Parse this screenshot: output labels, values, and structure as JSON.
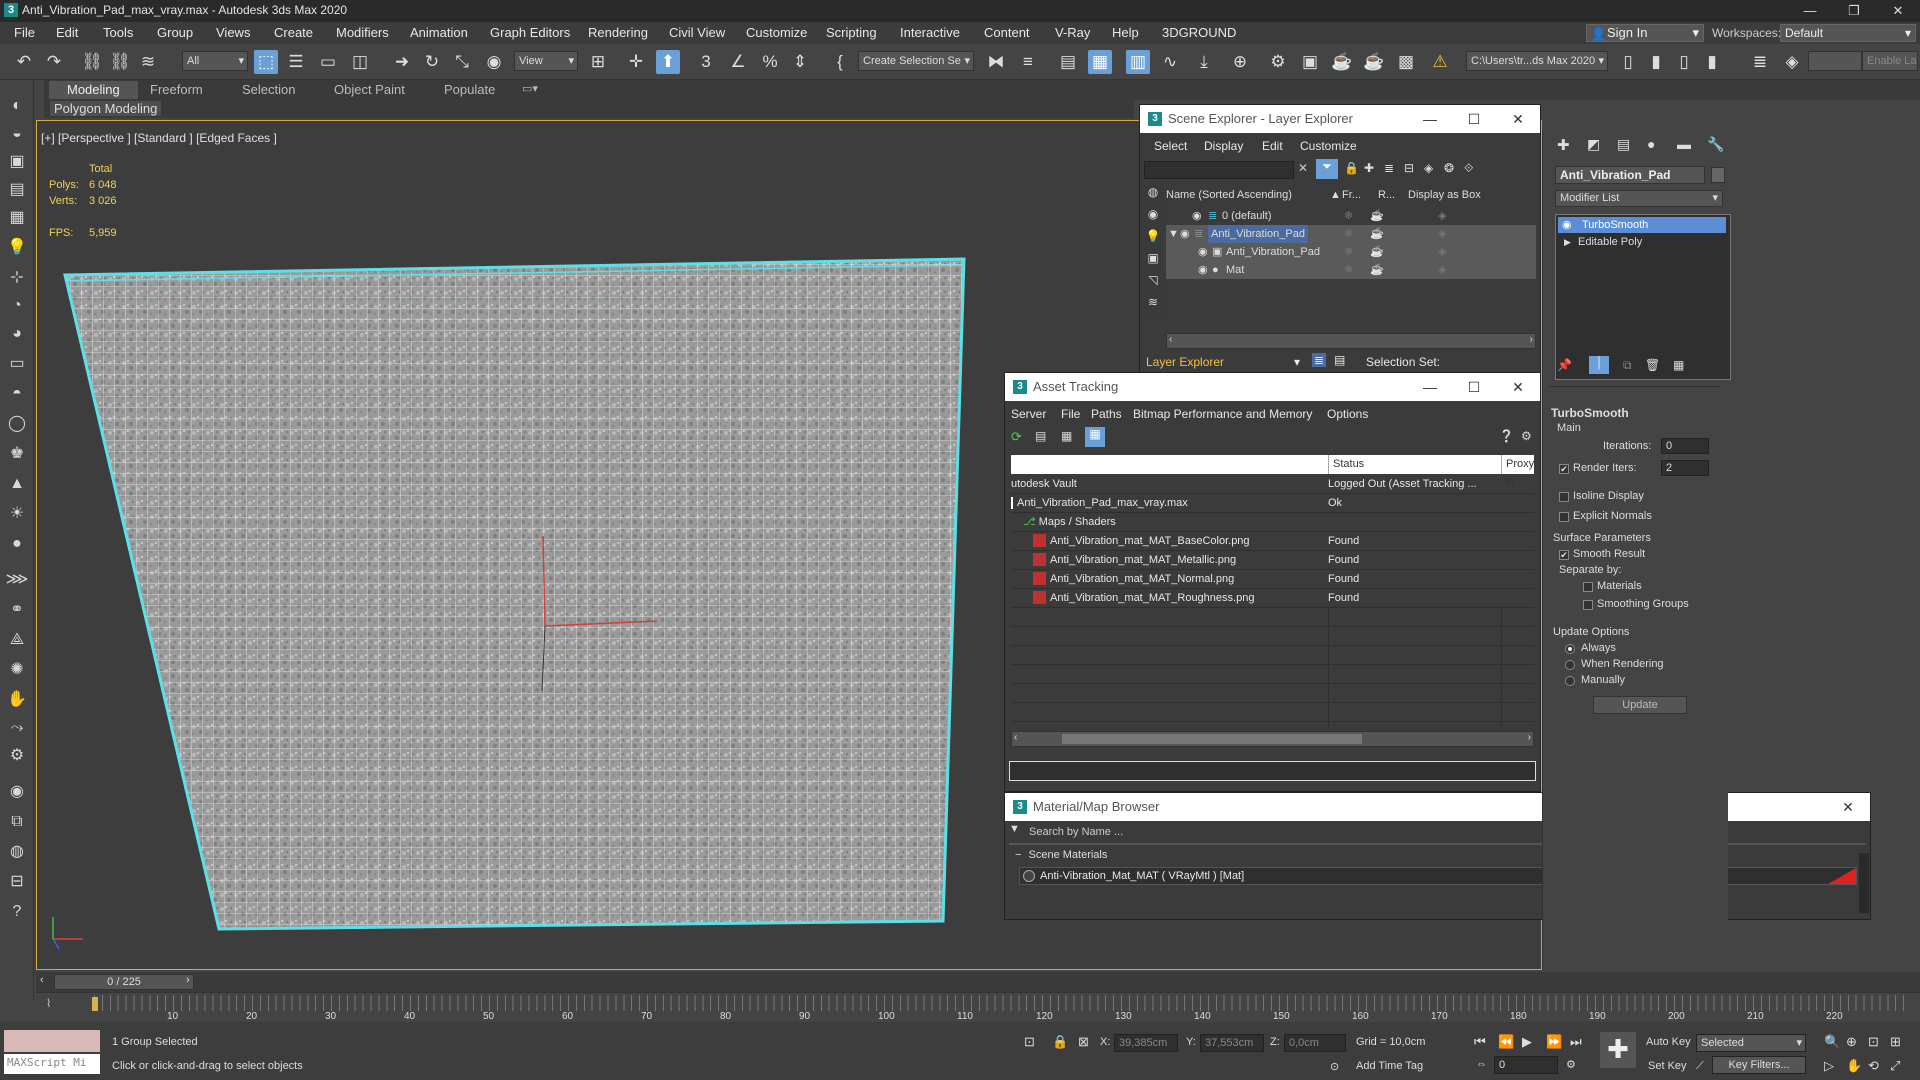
{
  "window": {
    "title": "Anti_Vibration_Pad_max_vray.max - Autodesk 3ds Max 2020",
    "minimize": "—",
    "maximize": "❐",
    "close": "✕"
  },
  "menu": {
    "items": [
      "File",
      "Edit",
      "Tools",
      "Group",
      "Views",
      "Create",
      "Modifiers",
      "Animation",
      "Graph Editors",
      "Rendering",
      "Civil View",
      "Customize",
      "Scripting",
      "Interactive",
      "Content",
      "V-Ray",
      "Help",
      "3DGROUND"
    ],
    "sign_in": "Sign In",
    "workspaces_label": "Workspaces:",
    "workspace": "Default"
  },
  "toolbar": {
    "filter": "All",
    "ref_coord": "View",
    "selection_set": "Create Selection Se",
    "project_path": "C:\\Users\\tr...ds Max 2020",
    "enable_label": "Enable La"
  },
  "ribbon": {
    "tabs": [
      "Modeling",
      "Freeform",
      "Selection",
      "Object Paint",
      "Populate"
    ],
    "sub_label": "Polygon Modeling"
  },
  "viewport": {
    "label": "[+] [Perspective ] [Standard ] [Edged Faces ]",
    "total_label": "Total",
    "polys_label": "Polys:",
    "polys_value": "6 048",
    "verts_label": "Verts:",
    "verts_value": "3 026",
    "fps_label": "FPS:",
    "fps_value": "5,959"
  },
  "scene_explorer": {
    "title": "Scene Explorer - Layer Explorer",
    "menu": [
      "Select",
      "Display",
      "Edit",
      "Customize"
    ],
    "columns": [
      "Name (Sorted Ascending)",
      "Fr...",
      "R...",
      "Display as Box"
    ],
    "rows": [
      "0 (default)",
      "Anti_Vibration_Pad",
      "Anti_Vibration_Pad",
      "Mat"
    ],
    "footer_left": "Layer Explorer",
    "footer_right": "Selection Set:"
  },
  "asset_tracking": {
    "title": "Asset Tracking",
    "menu": [
      "Server",
      "File",
      "Paths",
      "Bitmap Performance and Memory",
      "Options"
    ],
    "col_status": "Status",
    "col_proxy": "Proxy R",
    "rows": [
      {
        "name": "utodesk Vault",
        "status": "Logged Out (Asset Tracking ..."
      },
      {
        "name": "Anti_Vibration_Pad_max_vray.max",
        "status": "Ok"
      },
      {
        "name": "Maps / Shaders",
        "status": ""
      },
      {
        "name": "Anti_Vibration_mat_MAT_BaseColor.png",
        "status": "Found"
      },
      {
        "name": "Anti_Vibration_mat_MAT_Metallic.png",
        "status": "Found"
      },
      {
        "name": "Anti_Vibration_mat_MAT_Normal.png",
        "status": "Found"
      },
      {
        "name": "Anti_Vibration_mat_MAT_Roughness.png",
        "status": "Found"
      }
    ]
  },
  "material_browser": {
    "title": "Material/Map Browser",
    "search_placeholder": "Search by Name ...",
    "group": "Scene Materials",
    "item": "Anti-Vibration_Mat_MAT ( VRayMtl ) [Mat]"
  },
  "command_panel": {
    "object_name": "Anti_Vibration_Pad",
    "modifier_list": "Modifier List",
    "stack": [
      "TurboSmooth",
      "Editable Poly"
    ],
    "rollout": "TurboSmooth",
    "main": "Main",
    "iterations_label": "Iterations:",
    "iterations_value": "0",
    "render_iters_label": "Render Iters:",
    "render_iters_value": "2",
    "isoline": "Isoline Display",
    "explicit_normals": "Explicit Normals",
    "surface_params": "Surface Parameters",
    "smooth_result": "Smooth Result",
    "separate_by": "Separate by:",
    "materials": "Materials",
    "smoothing_groups": "Smoothing Groups",
    "update_options": "Update Options",
    "always": "Always",
    "when_rendering": "When Rendering",
    "manually": "Manually",
    "update_button": "Update"
  },
  "timeline": {
    "frame": "0 / 225",
    "ticks": [
      "10",
      "20",
      "30",
      "40",
      "50",
      "60",
      "70",
      "80",
      "90",
      "100",
      "110",
      "120",
      "130",
      "140",
      "150",
      "160",
      "170",
      "180",
      "190",
      "200",
      "210",
      "220"
    ]
  },
  "status": {
    "maxscript": "MAXScript Mi",
    "selected": "1 Group Selected",
    "hint": "Click or click-and-drag to select objects",
    "x_label": "X:",
    "x_value": "39,385cm",
    "y_label": "Y:",
    "y_value": "37,553cm",
    "z_label": "Z:",
    "z_value": "0,0cm",
    "grid": "Grid = 10,0cm",
    "add_time_tag": "Add Time Tag",
    "auto_key": "Auto Key",
    "set_key": "Set Key",
    "selected_dropdown": "Selected",
    "key_filters": "Key Filters...",
    "frame_value": "0"
  }
}
